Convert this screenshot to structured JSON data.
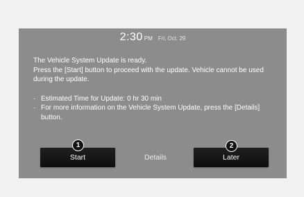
{
  "status_bar": {
    "time": "2:30",
    "ampm": "PM",
    "date": "Fri, Oct. 29"
  },
  "message": {
    "headline": "The Vehicle System Update is ready.",
    "body": "Press the [Start] button to proceed with the update. Vehicle cannot be used during the update.",
    "bullets": [
      "Estimated Time for Update: 0 hr 30 min",
      "For more information on the Vehicle System Update, press the [Details] button."
    ],
    "bullet_symbol": "·"
  },
  "buttons": {
    "start_label": "Start",
    "details_label": "Details",
    "later_label": "Later"
  },
  "markers": {
    "start": "1",
    "later": "2"
  },
  "colors": {
    "page_background": "#f2f2f2",
    "screen_background": "#8c8c8c",
    "button_background": "#151515",
    "text": "#ffffff"
  }
}
